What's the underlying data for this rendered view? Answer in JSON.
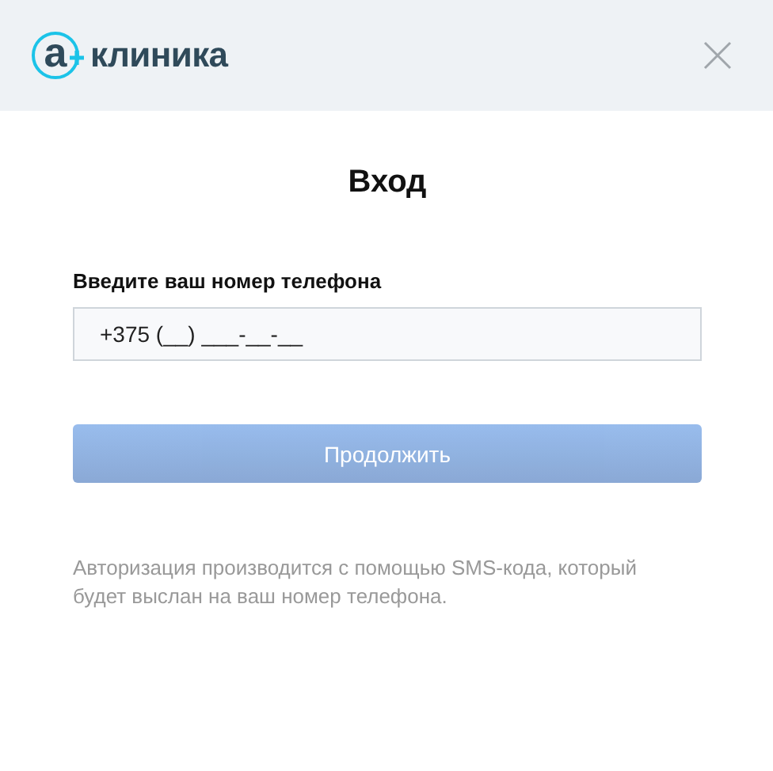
{
  "header": {
    "logo": {
      "letter": "а",
      "name": "клиника"
    }
  },
  "title": "Вход",
  "phone_field": {
    "label": "Введите ваш номер телефона",
    "value": "+375 (__) ___-__-__"
  },
  "continue_button": {
    "label": "Продолжить",
    "disabled": true
  },
  "note": "Авторизация производится с помощью SMS-кода, который будет выслан на ваш номер телефона."
}
